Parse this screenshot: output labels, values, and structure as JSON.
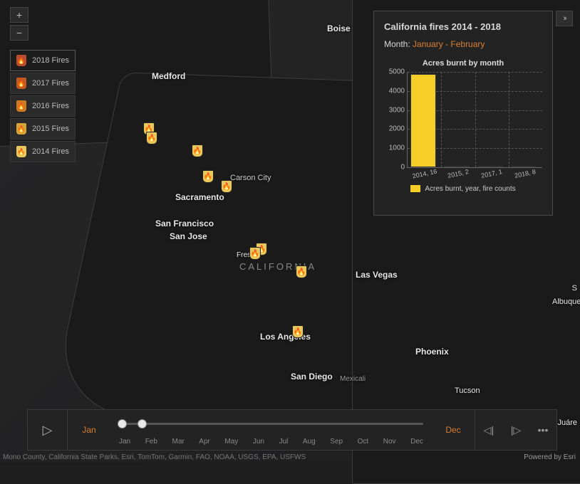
{
  "header": {
    "title": "California fires 2014 - 2018",
    "month_label": "Month:",
    "month_value": "January - February"
  },
  "legend_items": [
    {
      "label": "2018 Fires",
      "cls": "c2018"
    },
    {
      "label": "2017 Fires",
      "cls": "c2017"
    },
    {
      "label": "2016 Fires",
      "cls": "c2016"
    },
    {
      "label": "2015 Fires",
      "cls": "c2015"
    },
    {
      "label": "2014 Fires",
      "cls": "c2014"
    }
  ],
  "zoom": {
    "in": "+",
    "out": "−"
  },
  "cities": {
    "boise": "Boise",
    "medford": "Medford",
    "carson_city": "Carson City",
    "sacramento": "Sacramento",
    "san_francisco": "San Francisco",
    "san_jose": "San Jose",
    "fresno": "Fresno",
    "las_vegas": "Las Vegas",
    "los_angeles": "Los Angeles",
    "phoenix": "Phoenix",
    "san_diego": "San Diego",
    "mexicali": "Mexicali",
    "tucson": "Tucson",
    "albuquerque": "Albuquer",
    "juarez": "Juáre"
  },
  "state_label": "CALIFORNIA",
  "chart_data": {
    "type": "bar",
    "title": "Acres burnt by month",
    "categories": [
      "2014, 16",
      "2015, 2",
      "2017, 1",
      "2018, 8"
    ],
    "values": [
      4900,
      40,
      30,
      20
    ],
    "ylim": [
      0,
      5000
    ],
    "yticks": [
      0,
      1000,
      2000,
      3000,
      4000,
      5000
    ],
    "legend": "Acres burnt, year, fire counts"
  },
  "timeline": {
    "start_label": "Jan",
    "end_label": "Dec",
    "months": [
      "Jan",
      "Feb",
      "Mar",
      "Apr",
      "May",
      "Jun",
      "Jul",
      "Aug",
      "Sep",
      "Oct",
      "Nov",
      "Dec"
    ],
    "play_icon": "▷",
    "prev_icon": "◁|",
    "next_icon": "|▷",
    "more_icon": "•••"
  },
  "expand_icon": "››",
  "attribution": "Mono County, California State Parks, Esri, TomTom, Garmin, FAO, NOAA, USGS, EPA, USFWS",
  "powered": "Powered by Esri"
}
